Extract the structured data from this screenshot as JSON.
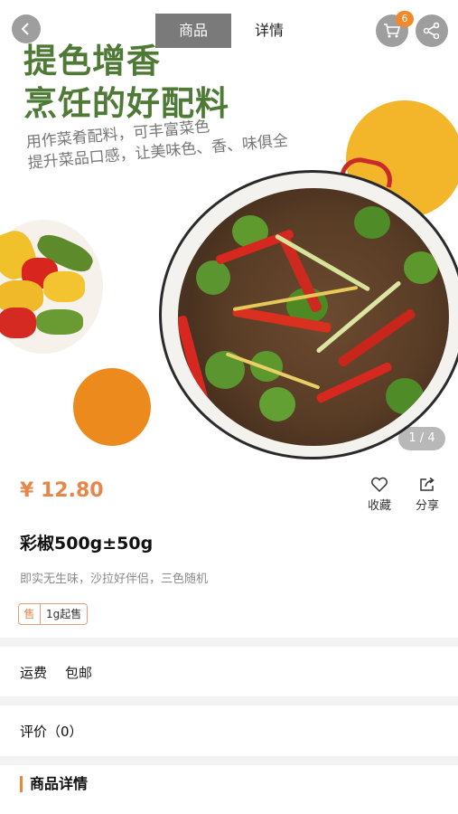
{
  "header": {
    "tabs": [
      {
        "label": "商品",
        "active": true
      },
      {
        "label": "详情",
        "active": false
      }
    ],
    "cart_count": "6",
    "icons": [
      "back-arrow-icon",
      "cart-icon",
      "share-icon"
    ]
  },
  "hero": {
    "headline_line1": "提色增香",
    "headline_line2": "烹饪的好配料",
    "subline_line1": "用作菜肴配料，可丰富菜色",
    "subline_line2": "提升菜品口感，让美味色、香、味俱全",
    "page_indicator": "1 / 4",
    "colors": {
      "headline": "#4e7a36",
      "yellow": "#f3b62b",
      "orange": "#ec8a1d"
    }
  },
  "product": {
    "price": "¥ 12.80",
    "favorite_label": "收藏",
    "share_label": "分享",
    "title": "彩椒500g±50g",
    "description": "即实无生味，沙拉好伴侣，三色随机",
    "tag_icon": "售",
    "tag_text": "1g起售"
  },
  "shipping": {
    "label": "运费",
    "value": "包邮"
  },
  "reviews": {
    "label": "评价（0）"
  },
  "details": {
    "heading": "商品详情"
  },
  "accent_color": "#e8864a"
}
